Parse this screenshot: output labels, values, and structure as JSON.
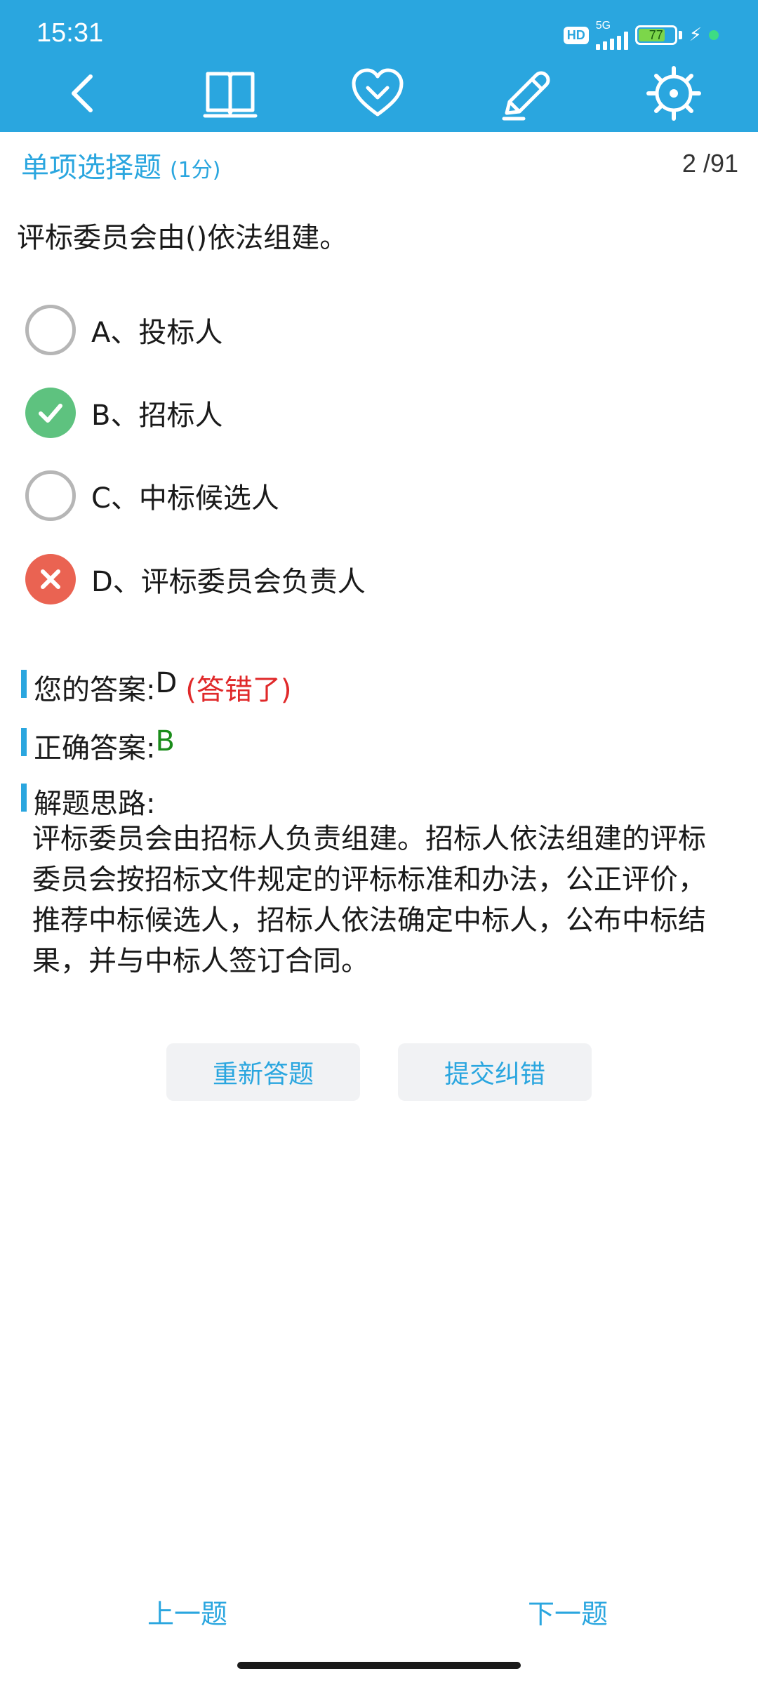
{
  "status": {
    "time": "15:31",
    "hd": "HD",
    "network": "5G",
    "battery": "77",
    "battery_level_percent": 77
  },
  "toolbar": {
    "icons": [
      "back-icon",
      "book-icon",
      "heart-icon",
      "pencil-icon",
      "settings-icon"
    ]
  },
  "question": {
    "type": "单项选择题",
    "score": "(1分)",
    "progress": "2 /91",
    "text": "评标委员会由()依法组建。",
    "options": [
      {
        "label": "A、投标人",
        "state": "unselected"
      },
      {
        "label": "B、招标人",
        "state": "correct"
      },
      {
        "label": "C、中标候选人",
        "state": "unselected"
      },
      {
        "label": "D、评标委员会负责人",
        "state": "wrong"
      }
    ]
  },
  "result": {
    "your_answer_label": "您的答案:",
    "your_answer": "D",
    "wrong_note": "(答错了)",
    "correct_answer_label": "正确答案:",
    "correct_answer": "B",
    "explanation_label": "解题思路:",
    "explanation": "评标委员会由招标人负责组建。招标人依法组建的评标委员会按招标文件规定的评标标准和办法，公正评价，推荐中标候选人，招标人依法确定中标人，公布中标结果，并与中标人签订合同。"
  },
  "actions": {
    "retry": "重新答题",
    "report": "提交纠错"
  },
  "nav": {
    "prev": "上一题",
    "next": "下一题"
  },
  "colors": {
    "accent": "#2aa6df",
    "correct": "#5ec27f",
    "wrong": "#ea6352",
    "wrong_text": "#e0292a",
    "correct_text": "#1a8c1a"
  }
}
